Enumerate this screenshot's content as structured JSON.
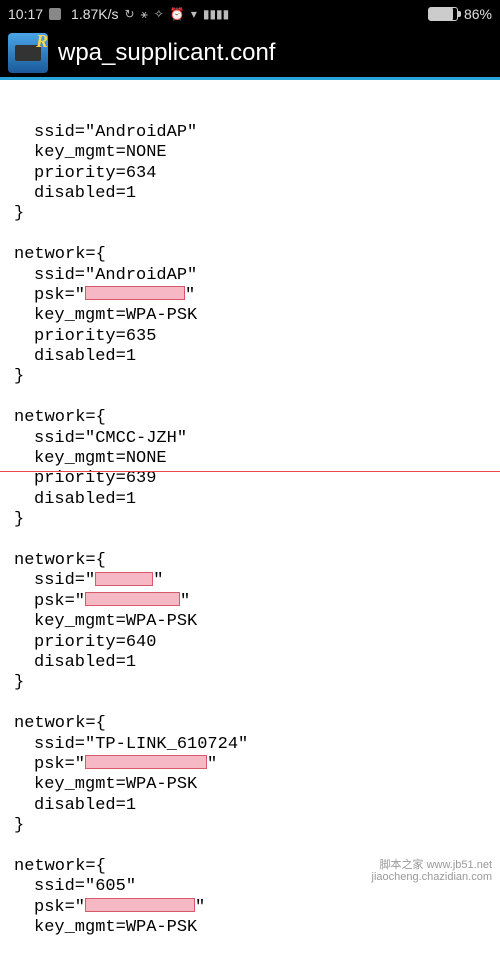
{
  "status": {
    "time": "10:17",
    "speed": "1.87K/s",
    "battery_pct": "86%"
  },
  "header": {
    "title": "wpa_supplicant.conf"
  },
  "blocks": [
    {
      "open": "",
      "lines": [
        "ssid=\"AndroidAP\"",
        "key_mgmt=NONE",
        "priority=634",
        "disabled=1"
      ],
      "close": "}"
    },
    {
      "open": "network={",
      "lines": [
        "ssid=\"AndroidAP\"",
        {
          "prefix": "psk=\"",
          "redact": "w1",
          "suffix": "\""
        },
        "key_mgmt=WPA-PSK",
        "priority=635",
        "disabled=1"
      ],
      "close": "}"
    },
    {
      "open": "network={",
      "lines": [
        "ssid=\"CMCC-JZH\"",
        "key_mgmt=NONE",
        "priority=639",
        "disabled=1"
      ],
      "close": "}"
    },
    {
      "open": "network={",
      "lines": [
        {
          "prefix": "ssid=\"",
          "redact": "w2",
          "suffix": "\""
        },
        {
          "prefix": "psk=\"",
          "redact": "w3",
          "suffix": "\""
        },
        "key_mgmt=WPA-PSK",
        "priority=640",
        "disabled=1"
      ],
      "close": "}"
    },
    {
      "open": "network={",
      "lines": [
        "ssid=\"TP-LINK_610724\"",
        {
          "prefix": "psk=\"",
          "redact": "w4",
          "suffix": "\""
        },
        "key_mgmt=WPA-PSK",
        "disabled=1"
      ],
      "close": "}"
    },
    {
      "open": "network={",
      "lines": [
        "ssid=\"605\"",
        {
          "prefix": "psk=\"",
          "redact": "w5",
          "suffix": "\""
        },
        "key_mgmt=WPA-PSK"
      ],
      "close": ""
    }
  ],
  "watermark": {
    "line1": "脚本之家 www.jb51.net",
    "line2": "jiaocheng.chazidian.com"
  }
}
